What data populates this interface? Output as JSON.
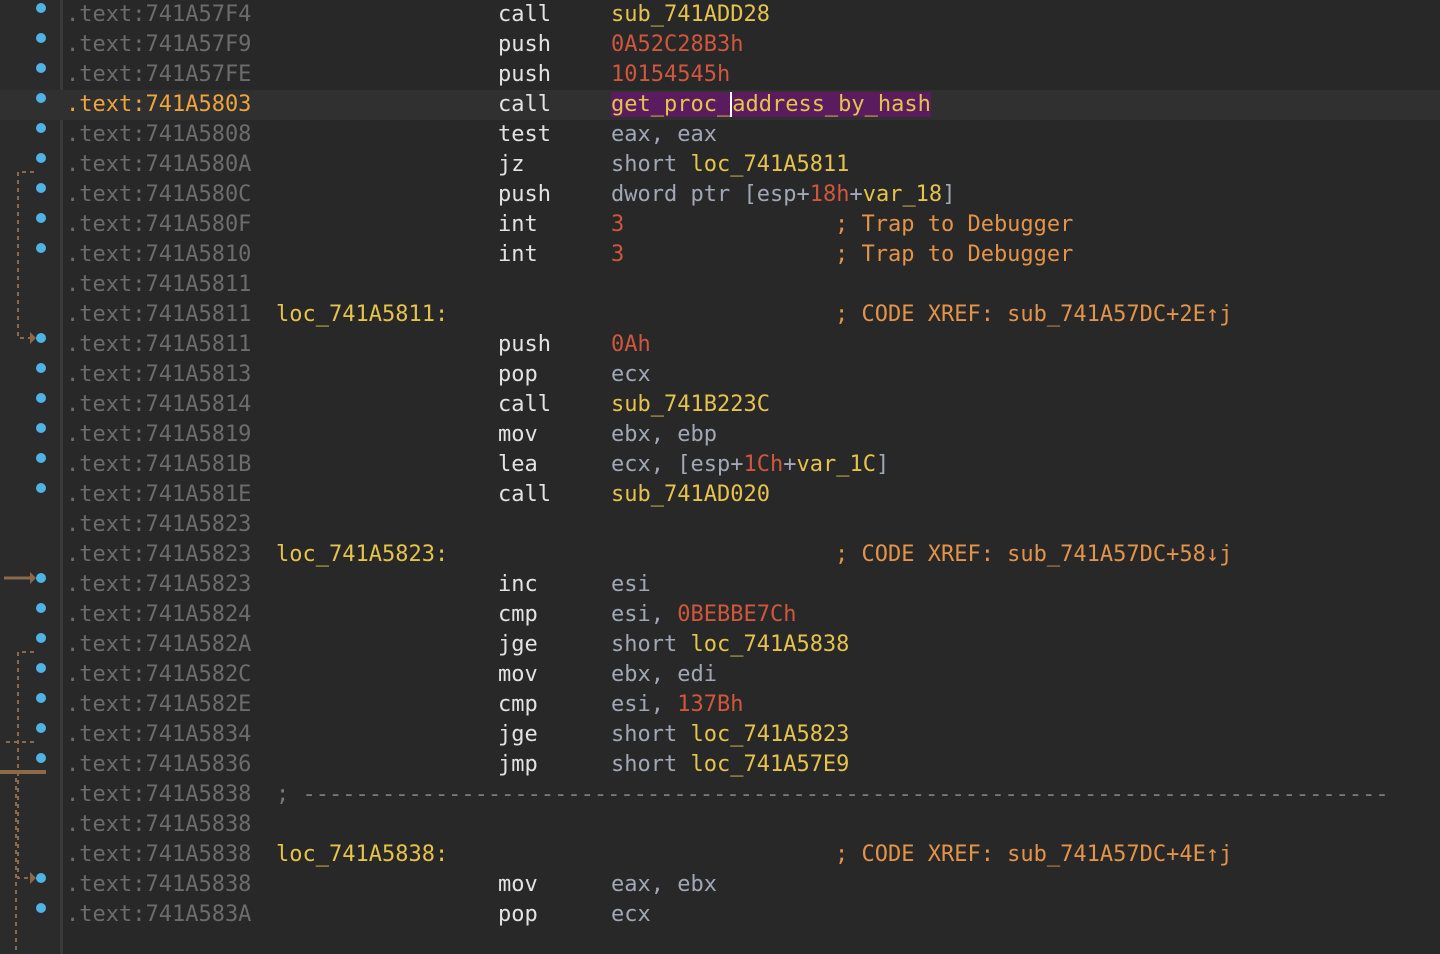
{
  "colors": {
    "background": "#282828",
    "address": "#6c6c6c",
    "current_address": "#f0a43c",
    "mnemonic": "#e3e3e3",
    "register": "#a0a8b8",
    "number": "#d0573e",
    "symbol": "#e6c34a",
    "comment": "#e3944a",
    "highlight": "#5a1c5e",
    "breakpoint": "#4fb3e6"
  },
  "lines": [
    {
      "addr": ".text:741A57F4",
      "mnem": "call",
      "ops": [
        {
          "t": "sub_741ADD28",
          "c": "sym"
        }
      ],
      "bp": true
    },
    {
      "addr": ".text:741A57F9",
      "mnem": "push",
      "ops": [
        {
          "t": "0A52C28B3h",
          "c": "num"
        }
      ],
      "bp": true
    },
    {
      "addr": ".text:741A57FE",
      "mnem": "push",
      "ops": [
        {
          "t": "10154545h",
          "c": "num"
        }
      ],
      "bp": true
    },
    {
      "addr": ".text:741A5803",
      "mnem": "call",
      "ops": [
        {
          "t": "get_proc_",
          "c": "hl"
        },
        {
          "t": "address_by_hash",
          "c": "caret"
        }
      ],
      "bp": true,
      "current": true
    },
    {
      "addr": ".text:741A5808",
      "mnem": "test",
      "ops": [
        {
          "t": "eax",
          "c": "reg"
        },
        {
          "t": ", ",
          "c": "punc"
        },
        {
          "t": "eax",
          "c": "reg"
        }
      ],
      "bp": true
    },
    {
      "addr": ".text:741A580A",
      "mnem": "jz",
      "ops": [
        {
          "t": "short ",
          "c": "kw"
        },
        {
          "t": "loc_741A5811",
          "c": "sym"
        }
      ],
      "bp": true
    },
    {
      "addr": ".text:741A580C",
      "mnem": "push",
      "ops": [
        {
          "t": "dword ptr [",
          "c": "kw"
        },
        {
          "t": "esp",
          "c": "reg"
        },
        {
          "t": "+",
          "c": "punc"
        },
        {
          "t": "18h",
          "c": "num"
        },
        {
          "t": "+",
          "c": "punc"
        },
        {
          "t": "var_18",
          "c": "var"
        },
        {
          "t": "]",
          "c": "punc"
        }
      ],
      "bp": true
    },
    {
      "addr": ".text:741A580F",
      "mnem": "int",
      "ops": [
        {
          "t": "3",
          "c": "num"
        }
      ],
      "comment": "; Trap to Debugger",
      "bp": true
    },
    {
      "addr": ".text:741A5810",
      "mnem": "int",
      "ops": [
        {
          "t": "3",
          "c": "num"
        }
      ],
      "comment": "; Trap to Debugger",
      "bp": true
    },
    {
      "addr": ".text:741A5811"
    },
    {
      "addr": ".text:741A5811",
      "label": "loc_741A5811:",
      "comment": "; CODE XREF: sub_741A57DC+2E↑j"
    },
    {
      "addr": ".text:741A5811",
      "mnem": "push",
      "ops": [
        {
          "t": "0Ah",
          "c": "num"
        }
      ],
      "bp": true
    },
    {
      "addr": ".text:741A5813",
      "mnem": "pop",
      "ops": [
        {
          "t": "ecx",
          "c": "reg"
        }
      ],
      "bp": true
    },
    {
      "addr": ".text:741A5814",
      "mnem": "call",
      "ops": [
        {
          "t": "sub_741B223C",
          "c": "sym"
        }
      ],
      "bp": true
    },
    {
      "addr": ".text:741A5819",
      "mnem": "mov",
      "ops": [
        {
          "t": "ebx",
          "c": "reg"
        },
        {
          "t": ", ",
          "c": "punc"
        },
        {
          "t": "ebp",
          "c": "reg"
        }
      ],
      "bp": true
    },
    {
      "addr": ".text:741A581B",
      "mnem": "lea",
      "ops": [
        {
          "t": "ecx",
          "c": "reg"
        },
        {
          "t": ", [",
          "c": "punc"
        },
        {
          "t": "esp",
          "c": "reg"
        },
        {
          "t": "+",
          "c": "punc"
        },
        {
          "t": "1Ch",
          "c": "num"
        },
        {
          "t": "+",
          "c": "punc"
        },
        {
          "t": "var_1C",
          "c": "var"
        },
        {
          "t": "]",
          "c": "punc"
        }
      ],
      "bp": true
    },
    {
      "addr": ".text:741A581E",
      "mnem": "call",
      "ops": [
        {
          "t": "sub_741AD020",
          "c": "sym"
        }
      ],
      "bp": true
    },
    {
      "addr": ".text:741A5823"
    },
    {
      "addr": ".text:741A5823",
      "label": "loc_741A5823:",
      "comment": "; CODE XREF: sub_741A57DC+58↓j"
    },
    {
      "addr": ".text:741A5823",
      "mnem": "inc",
      "ops": [
        {
          "t": "esi",
          "c": "reg"
        }
      ],
      "bp": true
    },
    {
      "addr": ".text:741A5824",
      "mnem": "cmp",
      "ops": [
        {
          "t": "esi",
          "c": "reg"
        },
        {
          "t": ", ",
          "c": "punc"
        },
        {
          "t": "0BEBBE7Ch",
          "c": "num"
        }
      ],
      "bp": true
    },
    {
      "addr": ".text:741A582A",
      "mnem": "jge",
      "ops": [
        {
          "t": "short ",
          "c": "kw"
        },
        {
          "t": "loc_741A5838",
          "c": "sym"
        }
      ],
      "bp": true
    },
    {
      "addr": ".text:741A582C",
      "mnem": "mov",
      "ops": [
        {
          "t": "ebx",
          "c": "reg"
        },
        {
          "t": ", ",
          "c": "punc"
        },
        {
          "t": "edi",
          "c": "reg"
        }
      ],
      "bp": true
    },
    {
      "addr": ".text:741A582E",
      "mnem": "cmp",
      "ops": [
        {
          "t": "esi",
          "c": "reg"
        },
        {
          "t": ", ",
          "c": "punc"
        },
        {
          "t": "137Bh",
          "c": "num"
        }
      ],
      "bp": true
    },
    {
      "addr": ".text:741A5834",
      "mnem": "jge",
      "ops": [
        {
          "t": "short ",
          "c": "kw"
        },
        {
          "t": "loc_741A5823",
          "c": "sym"
        }
      ],
      "bp": true
    },
    {
      "addr": ".text:741A5836",
      "mnem": "jmp",
      "ops": [
        {
          "t": "short ",
          "c": "kw"
        },
        {
          "t": "loc_741A57E9",
          "c": "sym"
        }
      ],
      "bp": true
    },
    {
      "addr": ".text:741A5838",
      "separator": "; ----------------------------------------------------------------------------------"
    },
    {
      "addr": ".text:741A5838"
    },
    {
      "addr": ".text:741A5838",
      "label": "loc_741A5838:",
      "comment": "; CODE XREF: sub_741A57DC+4E↑j"
    },
    {
      "addr": ".text:741A5838",
      "mnem": "mov",
      "ops": [
        {
          "t": "eax",
          "c": "reg"
        },
        {
          "t": ", ",
          "c": "punc"
        },
        {
          "t": "ebx",
          "c": "reg"
        }
      ],
      "bp": true
    },
    {
      "addr": ".text:741A583A",
      "mnem": "pop",
      "ops": [
        {
          "t": "ecx",
          "c": "reg"
        }
      ],
      "bp": true
    }
  ]
}
